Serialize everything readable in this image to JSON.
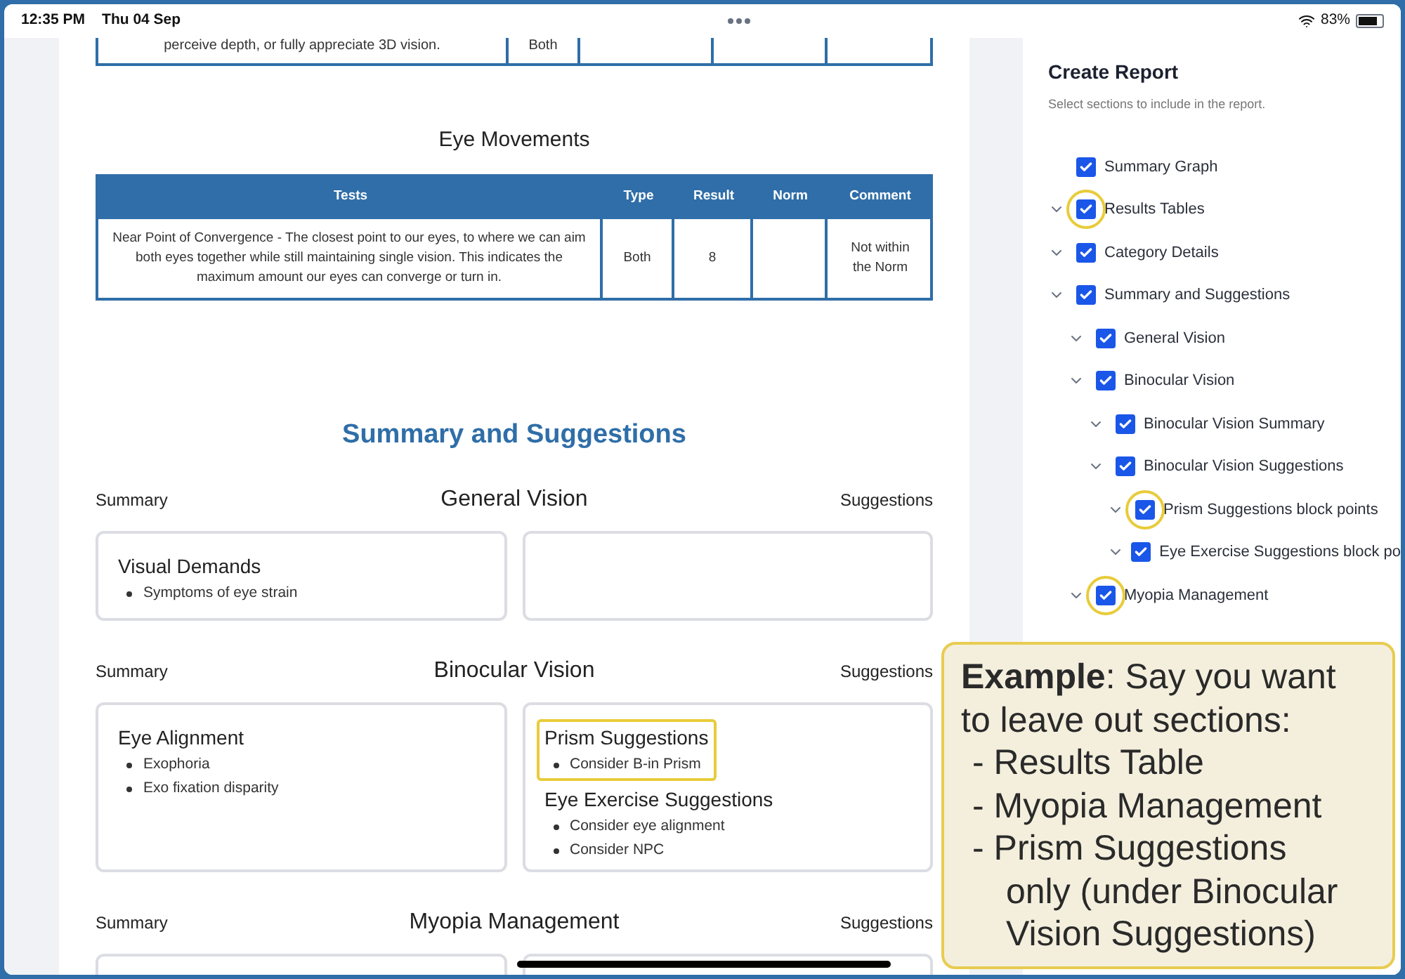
{
  "status_bar": {
    "time": "12:35 PM",
    "date": "Thu 04 Sep",
    "battery": "83%"
  },
  "document": {
    "partial_table": {
      "cells": [
        "perceive depth, or fully appreciate 3D vision.",
        "Both"
      ]
    },
    "eye_movements": {
      "title": "Eye Movements",
      "columns": [
        "Tests",
        "Type",
        "Result",
        "Norm",
        "Comment"
      ],
      "rows": [
        {
          "tests": "Near Point of Convergence - The closest point to our eyes, to where we can aim both eyes together while still maintaining single vision. This indicates the maximum amount our eyes can converge or turn in.",
          "type": "Both",
          "result": "8",
          "comment": "Not within the Norm"
        }
      ]
    },
    "summary_title": "Summary and Suggestions",
    "sections": [
      {
        "title": "General Vision",
        "summary_label": "Summary",
        "suggestions_label": "Suggestions",
        "summary_blocks": [
          {
            "title": "Visual Demands",
            "points": [
              "Symptoms of eye strain"
            ],
            "highlighted": false
          }
        ]
      },
      {
        "title": "Binocular Vision",
        "summary_label": "Summary",
        "suggestions_label": "Suggestions",
        "summary_blocks": [
          {
            "title": "Eye Alignment",
            "points": [
              "Exophoria",
              "Exo fixation disparity"
            ],
            "highlighted": false
          }
        ],
        "suggestion_blocks": [
          {
            "title": "Prism Suggestions",
            "points": [
              "Consider B-in Prism"
            ],
            "highlighted": true
          },
          {
            "title": "Eye Exercise Suggestions",
            "points": [
              "Consider eye alignment",
              "Consider NPC"
            ],
            "highlighted": false
          }
        ]
      },
      {
        "title": "Myopia Management",
        "summary_label": "Summary",
        "suggestions_label": "Suggestions"
      }
    ]
  },
  "panel": {
    "title": "Create Report",
    "subtitle": "Select sections to include in the report.",
    "tree": [
      {
        "label": "Summary Graph",
        "checked": true,
        "highlighted": false
      },
      {
        "label": "Results Tables",
        "checked": true,
        "expanded": true,
        "highlighted": true
      },
      {
        "label": "Category Details",
        "checked": true,
        "expanded": true,
        "highlighted": false
      },
      {
        "label": "Summary and Suggestions",
        "checked": true,
        "expanded": true,
        "highlighted": false,
        "children": [
          {
            "label": "General Vision",
            "checked": true,
            "expanded": true,
            "highlighted": false
          },
          {
            "label": "Binocular Vision",
            "checked": true,
            "expanded": true,
            "highlighted": false,
            "children": [
              {
                "label": "Binocular Vision Summary",
                "checked": true,
                "expanded": true,
                "highlighted": false
              },
              {
                "label": "Binocular Vision Suggestions",
                "checked": true,
                "expanded": true,
                "highlighted": false,
                "children": [
                  {
                    "label": "Prism Suggestions block points",
                    "checked": true,
                    "expanded": true,
                    "highlighted": true
                  },
                  {
                    "label": "Eye Exercise Suggestions block po",
                    "checked": true,
                    "expanded": true,
                    "highlighted": false
                  }
                ]
              }
            ]
          },
          {
            "label": "Myopia Management",
            "checked": true,
            "expanded": true,
            "highlighted": true
          }
        ]
      }
    ]
  },
  "callout": {
    "text": "**Example**: Say you want to leave out sections:",
    "items": [
      "- Results Table",
      "- Myopia Management",
      "- Prism Suggestions only (under Binocular Vision Suggestions)"
    ]
  }
}
